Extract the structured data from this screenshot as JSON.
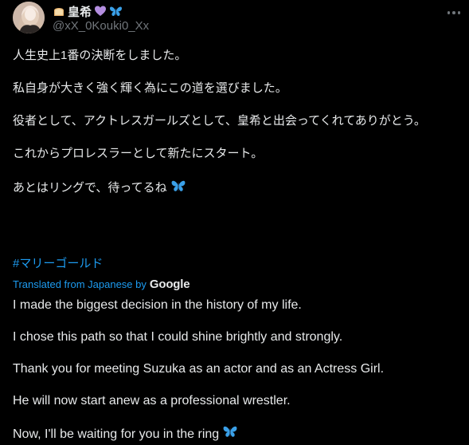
{
  "author": {
    "display_name": "皇希",
    "handle": "@xX_0Kouki0_Xx",
    "emojis": [
      "bread-emoji",
      "purple-heart-emoji",
      "butterfly-emoji"
    ]
  },
  "post": {
    "lines": [
      "人生史上1番の決断をしました。",
      "私自身が大きく強く輝く為にこの道を選びました。",
      "役者として、アクトレスガールズとして、皇希と出会ってくれてありがとう。",
      "これからプロレスラーとして新たにスタート。",
      "あとはリングで、待ってるね"
    ],
    "hashtag": "#マリーゴールド"
  },
  "translation": {
    "label": "Translated from Japanese by",
    "provider": "Google",
    "lines": [
      "I made the biggest decision in the history of my life.",
      "I chose this path so that I could shine brightly and strongly.",
      "Thank you for meeting Suzuka as an actor and as an Actress Girl.",
      "He will now start anew as a professional wrestler.",
      "Now, I'll be waiting for you in the ring"
    ]
  },
  "colors": {
    "background": "#000000",
    "text": "#e7e9ea",
    "secondary": "#71767b",
    "link": "#1d9bf0"
  },
  "icons": [
    "more-options-icon",
    "butterfly-emoji"
  ]
}
